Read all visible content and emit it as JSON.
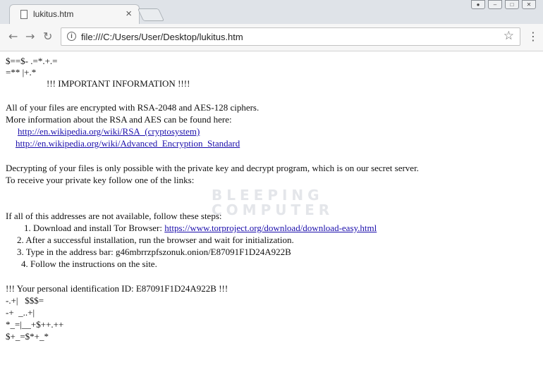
{
  "browser": {
    "tab_title": "lukitus.htm",
    "tab_close": "×",
    "url": "file:///C:/Users/User/Desktop/lukitus.htm"
  },
  "watermark": [
    "BLEEPING",
    "COMPUTER"
  ],
  "page": {
    "art_top_1": "$==$- .=*.+.=",
    "art_top_2": "=** |+.*",
    "heading": "!!! IMPORTANT INFORMATION !!!!",
    "p1_line1": "All of your files are encrypted with RSA-2048 and AES-128 ciphers.",
    "p1_line2": "More information about the RSA and AES can be found here:",
    "link_rsa": "http://en.wikipedia.org/wiki/RSA_(cryptosystem)",
    "link_aes": "http://en.wikipedia.org/wiki/Advanced_Encryption_Standard",
    "p2_line1": "Decrypting of your files is only possible with the private key and decrypt program, which is on our secret server.",
    "p2_line2": "To receive your private key follow one of the links:",
    "p3_intro": "If all of this addresses are not available, follow these steps:",
    "step1_text": "1. Download and install Tor Browser: ",
    "step1_link": "https://www.torproject.org/download/download-easy.html",
    "step2": "2. After a successful installation, run the browser and wait for initialization.",
    "step3": "3. Type in the address bar: g46mbrrzpfszonuk.onion/E87091F1D24A922B",
    "step4": "4. Follow the instructions on the site.",
    "personal_id": "!!! Your personal identification ID: E87091F1D24A922B !!!",
    "art_bottom_1": "-.+|   $$$=",
    "art_bottom_2": "-+  _..+|",
    "art_bottom_3": "*_=|__+$++.++",
    "art_bottom_4": "$+_=$*+_*"
  }
}
